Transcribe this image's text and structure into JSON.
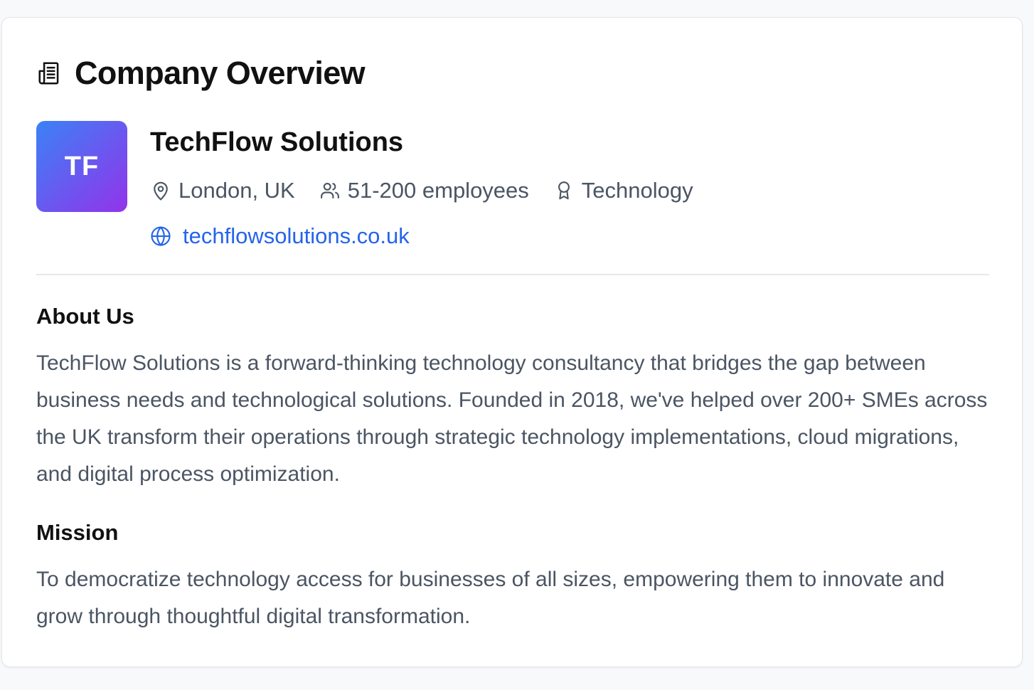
{
  "header": {
    "title": "Company Overview",
    "icon": "building-document-icon"
  },
  "company": {
    "initials": "TF",
    "name": "TechFlow Solutions",
    "location": "London, UK",
    "employees": "51-200 employees",
    "industry": "Technology",
    "website": "techflowsolutions.co.uk",
    "logo_gradient": [
      "#3b82f6",
      "#9333ea"
    ]
  },
  "about": {
    "heading": "About Us",
    "text": "TechFlow Solutions is a forward-thinking technology consultancy that bridges the gap between business needs and technological solutions. Founded in 2018, we've helped over 200+ SMEs across the UK transform their operations through strategic technology implementations, cloud migrations, and digital process optimization."
  },
  "mission": {
    "heading": "Mission",
    "text": "To democratize technology access for businesses of all sizes, empowering them to innovate and grow through thoughtful digital transformation."
  },
  "colors": {
    "link": "#2563eb",
    "muted_text": "#4b5563",
    "heading_text": "#111111"
  }
}
